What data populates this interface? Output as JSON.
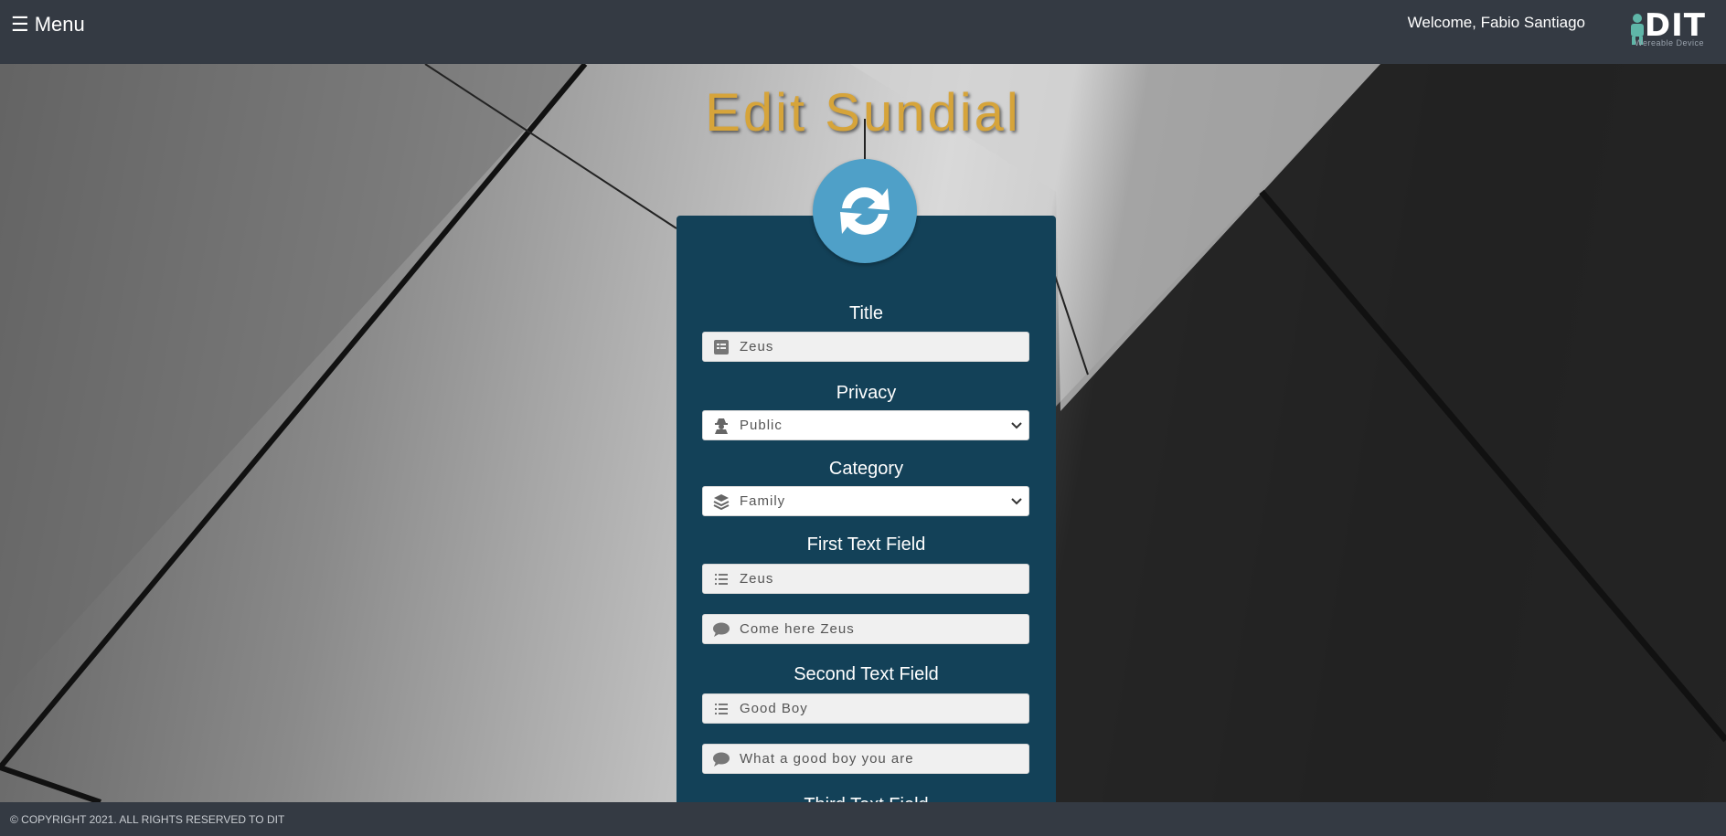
{
  "header": {
    "menu_icon": "hamburger-icon",
    "menu_label": "Menu",
    "welcome_text": "Welcome, Fabio Santiago",
    "logo_text": "DIT",
    "logo_subtext": "Wereable Device"
  },
  "page": {
    "title": "Edit Sundial",
    "header_icon": "sync-icon"
  },
  "form": {
    "title_label": "Title",
    "title_value": "Zeus",
    "privacy_label": "Privacy",
    "privacy_value": "Public",
    "category_label": "Category",
    "category_value": "Family",
    "first_label": "First Text Field",
    "first_title_value": "Zeus",
    "first_message_value": "Come here Zeus",
    "second_label": "Second Text Field",
    "second_title_value": "Good Boy",
    "second_message_value": "What a good boy you are",
    "third_label": "Third Text Field"
  },
  "footer": {
    "copyright": "© COPYRIGHT 2021. ALL RIGHTS RESERVED TO DIT"
  },
  "colors": {
    "header_bg": "#343a43",
    "title_gold": "#d6a43a",
    "card_bg": "#134158",
    "sync_circle": "#4fa0c8"
  }
}
